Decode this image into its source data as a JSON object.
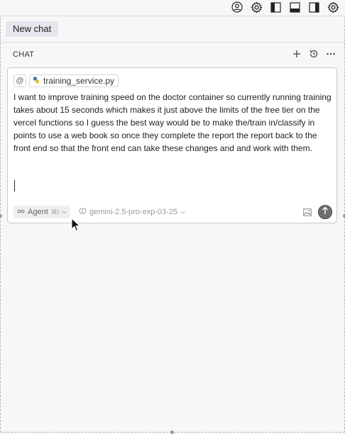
{
  "topbar": {
    "icons": [
      "account-icon",
      "settings-icon",
      "toggle-primary-sidebar-icon",
      "toggle-panel-icon",
      "toggle-secondary-sidebar-icon",
      "gear-icon"
    ]
  },
  "tabs": {
    "new_chat": "New chat"
  },
  "chat": {
    "title": "CHAT"
  },
  "composer": {
    "at_symbol": "@",
    "file_chip": "training_service.py",
    "message": "I want to improve training speed on the doctor container so currently running training takes about 15 seconds which makes it just above the limits of the free tier on the vercel functions so I guess the best way would be to make the/train in/classify in points to use a web book so once they complete the report the report back to the front end so that the front end can take these changes and and work with them.",
    "mode_label": "Agent",
    "mode_shortcut": "⌘I",
    "model_label": "gemini-2.5-pro-exp-03-25"
  },
  "colors": {
    "accent": "#e6e6ee",
    "send_button": "#6f6f6f"
  }
}
